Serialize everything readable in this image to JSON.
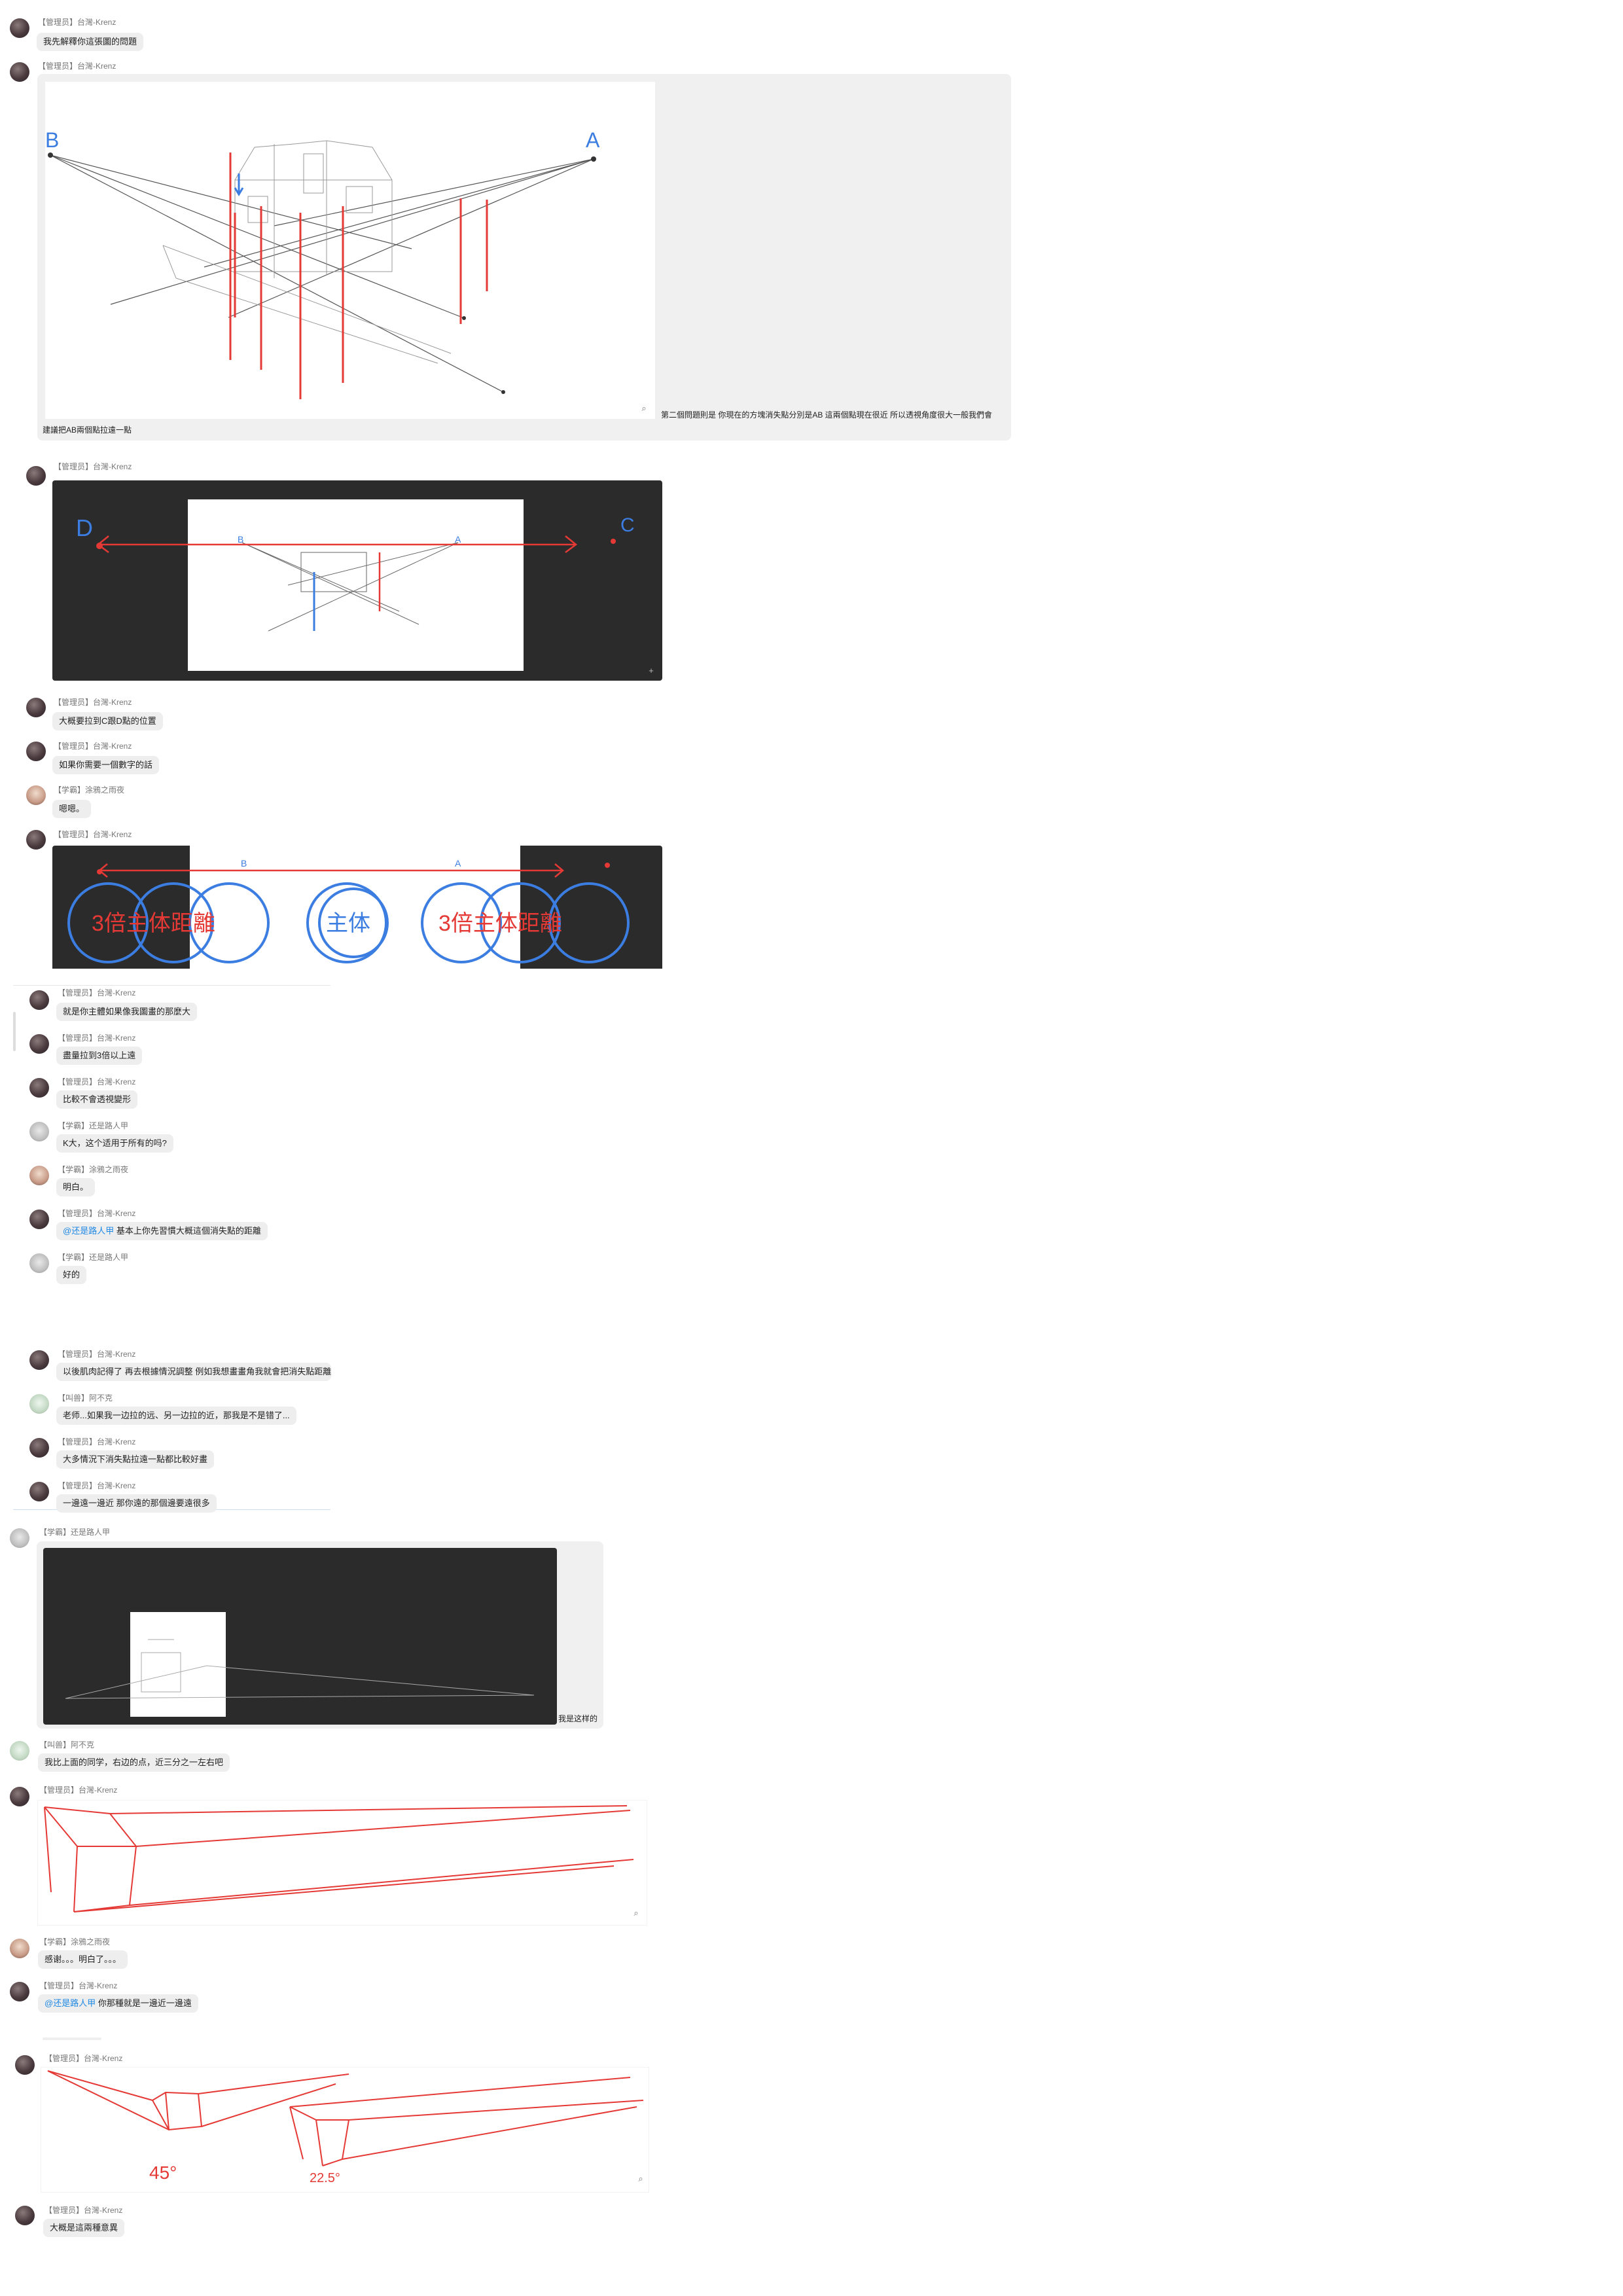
{
  "admin_name": "【管理员】台灣-Krenz",
  "student_1_name": "【学霸】涂鴉之雨夜",
  "student_2_name": "【学霸】还是路人甲",
  "student_3_name": "【叫兽】阿不克",
  "messages": {
    "m1": "我先解釋你這張圖的問題",
    "m2_caption": "建議把AB兩個點拉遠一點",
    "m2_side": "第二個問題則是 你現在的方塊消失點分別是AB 這兩個點現在很近 所以透視角度很大一般我們會",
    "m3": "大概要拉到C跟D點的位置",
    "m4": "如果你需要一個數字的話",
    "m5": "嗯嗯。",
    "m6": "就是你主體如果像我圖畫的那麼大",
    "m7": "盡量拉到3倍以上遠",
    "m8": "比較不會透視變形",
    "m9": "K大，这个适用于所有的吗?",
    "m10": "明白。",
    "m11_mention": "@还是路人甲",
    "m11": " 基本上你先習慣大概這個消失點的距離",
    "m12": "好的",
    "m13": "以後肌肉記得了 再去根據情況調整 例如我想畫畫角我就會把消失點距離拉近",
    "m14": "老师...如果我一边拉的远、另一边拉的近，那我是不是错了...",
    "m15": "大多情況下消失點拉遠一點都比較好畫",
    "m16": "一邊遠一邊近  那你遠的那個邊要遠很多",
    "m17_side": "我是这样的",
    "m18": "我比上面的同学，右边的点，近三分之一左右吧",
    "m19": "感谢。。。明白了。。。",
    "m20_mention": "@还是路人甲",
    "m20": " 你那種就是一邊近一邊遠",
    "m21": "大概是這兩種意異"
  },
  "sketch_labels": {
    "point_a": "A",
    "point_b": "B",
    "point_c": "C",
    "point_d": "D",
    "triple_left": "3倍主体距離",
    "subject": "主体",
    "triple_right": "3倍主体距離",
    "angle_45": "45°",
    "angle_225": "22.5°"
  },
  "icons": {
    "zoom": "magnifier-icon",
    "expand": "expand-icon"
  },
  "colors": {
    "bubble": "#eeeeee",
    "panel": "#f0f0f0",
    "dark_panel": "#2b2b2b",
    "mention": "#1e88e5",
    "sketch_red": "#e53935",
    "sketch_blue": "#3b7de0"
  }
}
